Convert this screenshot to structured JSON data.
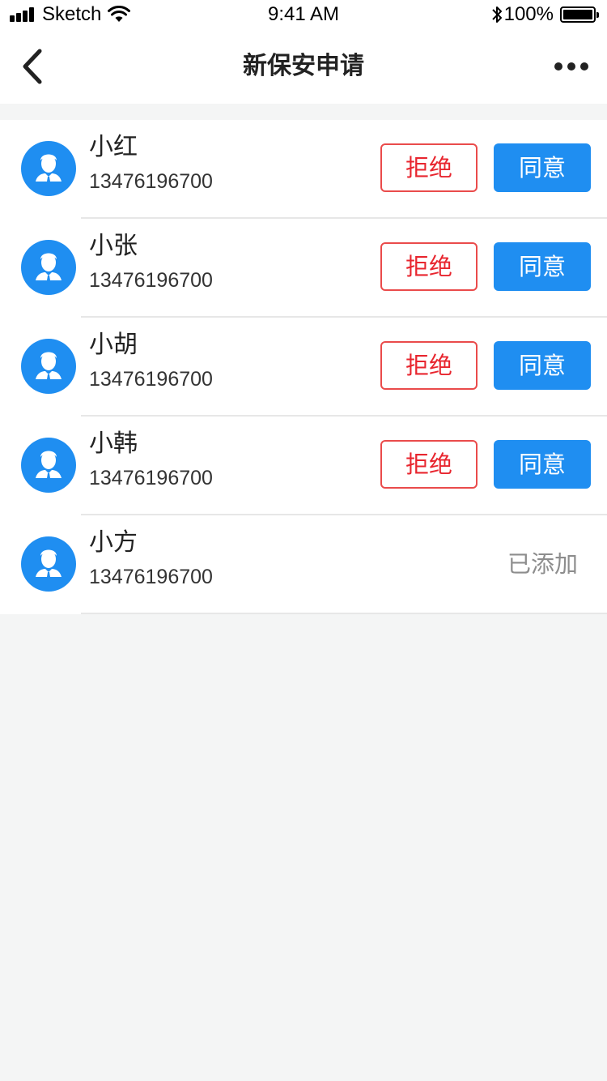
{
  "status_bar": {
    "carrier": "Sketch",
    "time": "9:41 AM",
    "battery": "100%"
  },
  "nav": {
    "title": "新保安申请",
    "back_icon": "chevron-left-icon",
    "more_icon": "more-icon"
  },
  "applicants": [
    {
      "name": "小红",
      "phone": "13476196700",
      "reject_label": "拒绝",
      "agree_label": "同意"
    },
    {
      "name": "小张",
      "phone": "13476196700",
      "reject_label": "拒绝",
      "agree_label": "同意"
    },
    {
      "name": "小胡",
      "phone": "13476196700",
      "reject_label": "拒绝",
      "agree_label": "同意"
    },
    {
      "name": "小韩",
      "phone": "13476196700",
      "reject_label": "拒绝",
      "agree_label": "同意"
    },
    {
      "name": "小方",
      "phone": "13476196700",
      "status": "已添加"
    }
  ],
  "colors": {
    "accent": "#1f8ef1",
    "reject": "#e8262f",
    "muted": "#8d8d8d",
    "background": "#f4f5f5"
  }
}
